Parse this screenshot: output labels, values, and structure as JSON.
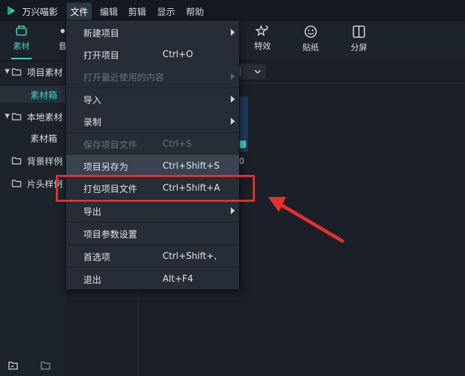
{
  "app": {
    "name": "万兴喵影"
  },
  "menubar": [
    "文件",
    "编辑",
    "剪辑",
    "显示",
    "帮助"
  ],
  "toolbar": {
    "items": [
      {
        "label": "素材",
        "icon": "media-icon",
        "active": true
      },
      {
        "label": "音",
        "icon": "audio-icon"
      },
      {
        "label": "特效",
        "icon": "effects-icon"
      },
      {
        "label": "贴纸",
        "icon": "sticker-icon"
      },
      {
        "label": "分屏",
        "icon": "split-screen-icon"
      }
    ]
  },
  "left_panel": {
    "tree": [
      {
        "label": "项目素材",
        "expanded": true
      },
      {
        "label": "素材箱",
        "selected": true
      },
      {
        "label": "本地素材",
        "expanded": true
      },
      {
        "label": "素材箱"
      },
      {
        "label": "背景样例"
      },
      {
        "label": "片头样例"
      }
    ]
  },
  "content": {
    "thumb_duration": "0"
  },
  "file_menu": {
    "items": [
      {
        "label": "新建项目",
        "shortcut": "",
        "submenu": true
      },
      {
        "label": "打开项目",
        "shortcut": "Ctrl+O"
      },
      {
        "label": "打开最近使用的内容",
        "shortcut": "",
        "submenu": true,
        "disabled": true
      },
      {
        "label": "导入",
        "shortcut": "",
        "submenu": true
      },
      {
        "label": "录制",
        "shortcut": "",
        "submenu": true
      },
      {
        "label": "保存项目文件",
        "shortcut": "Ctrl+S",
        "disabled": true
      },
      {
        "label": "项目另存为",
        "shortcut": "Ctrl+Shift+S"
      },
      {
        "label": "打包项目文件",
        "shortcut": "Ctrl+Shift+A",
        "highlighted": true
      },
      {
        "label": "导出",
        "shortcut": "",
        "submenu": true
      },
      {
        "label": "项目参数设置",
        "shortcut": ""
      },
      {
        "label": "首选项",
        "shortcut": "Ctrl+Shift+,"
      },
      {
        "label": "退出",
        "shortcut": "Alt+F4"
      }
    ]
  },
  "colors": {
    "accent": "#3fd6c0",
    "annotation": "#e8312b",
    "menu_bg": "#262d36"
  }
}
